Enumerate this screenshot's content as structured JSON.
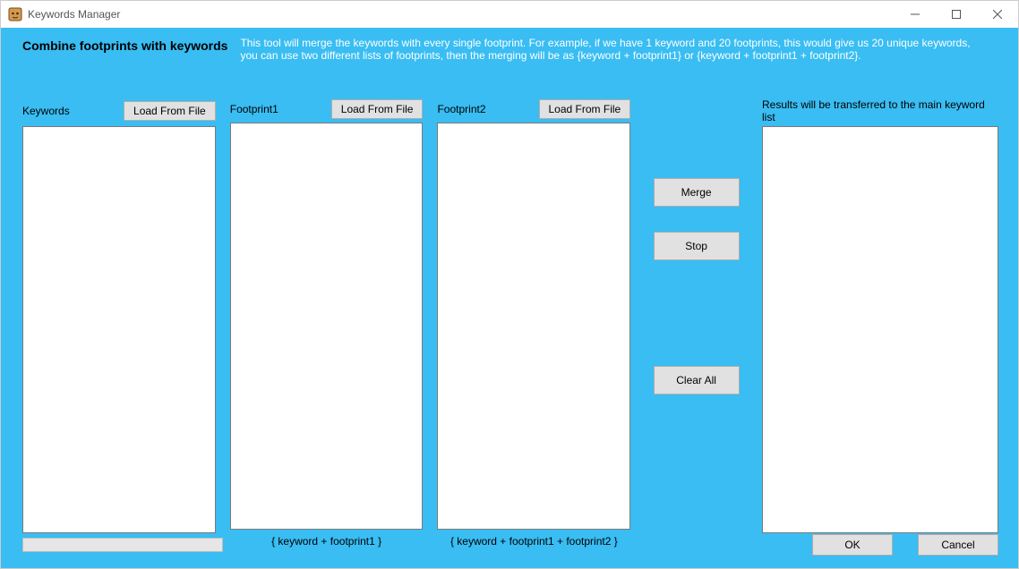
{
  "window": {
    "title": "Keywords Manager"
  },
  "header": {
    "title": "Combine footprints with keywords",
    "description": "This tool will merge the keywords with every single footprint. For example, if we have 1 keyword and 20 footprints, this would give us 20 unique keywords, you can use two different lists of footprints, then the merging will be as {keyword + footprint1} or {keyword + footprint1 + footprint2}."
  },
  "columns": {
    "keywords": {
      "label": "Keywords",
      "load_button": "Load From File",
      "value": ""
    },
    "footprint1": {
      "label": "Footprint1",
      "load_button": "Load From File",
      "value": "",
      "footer": "{ keyword + footprint1 }"
    },
    "footprint2": {
      "label": "Footprint2",
      "load_button": "Load From File",
      "value": "",
      "footer": "{ keyword + footprint1 + footprint2 }"
    },
    "results": {
      "label": "Results will be transferred to the main keyword list"
    }
  },
  "actions": {
    "merge": "Merge",
    "stop": "Stop",
    "clear_all": "Clear All"
  },
  "footer": {
    "ok": "OK",
    "cancel": "Cancel"
  }
}
